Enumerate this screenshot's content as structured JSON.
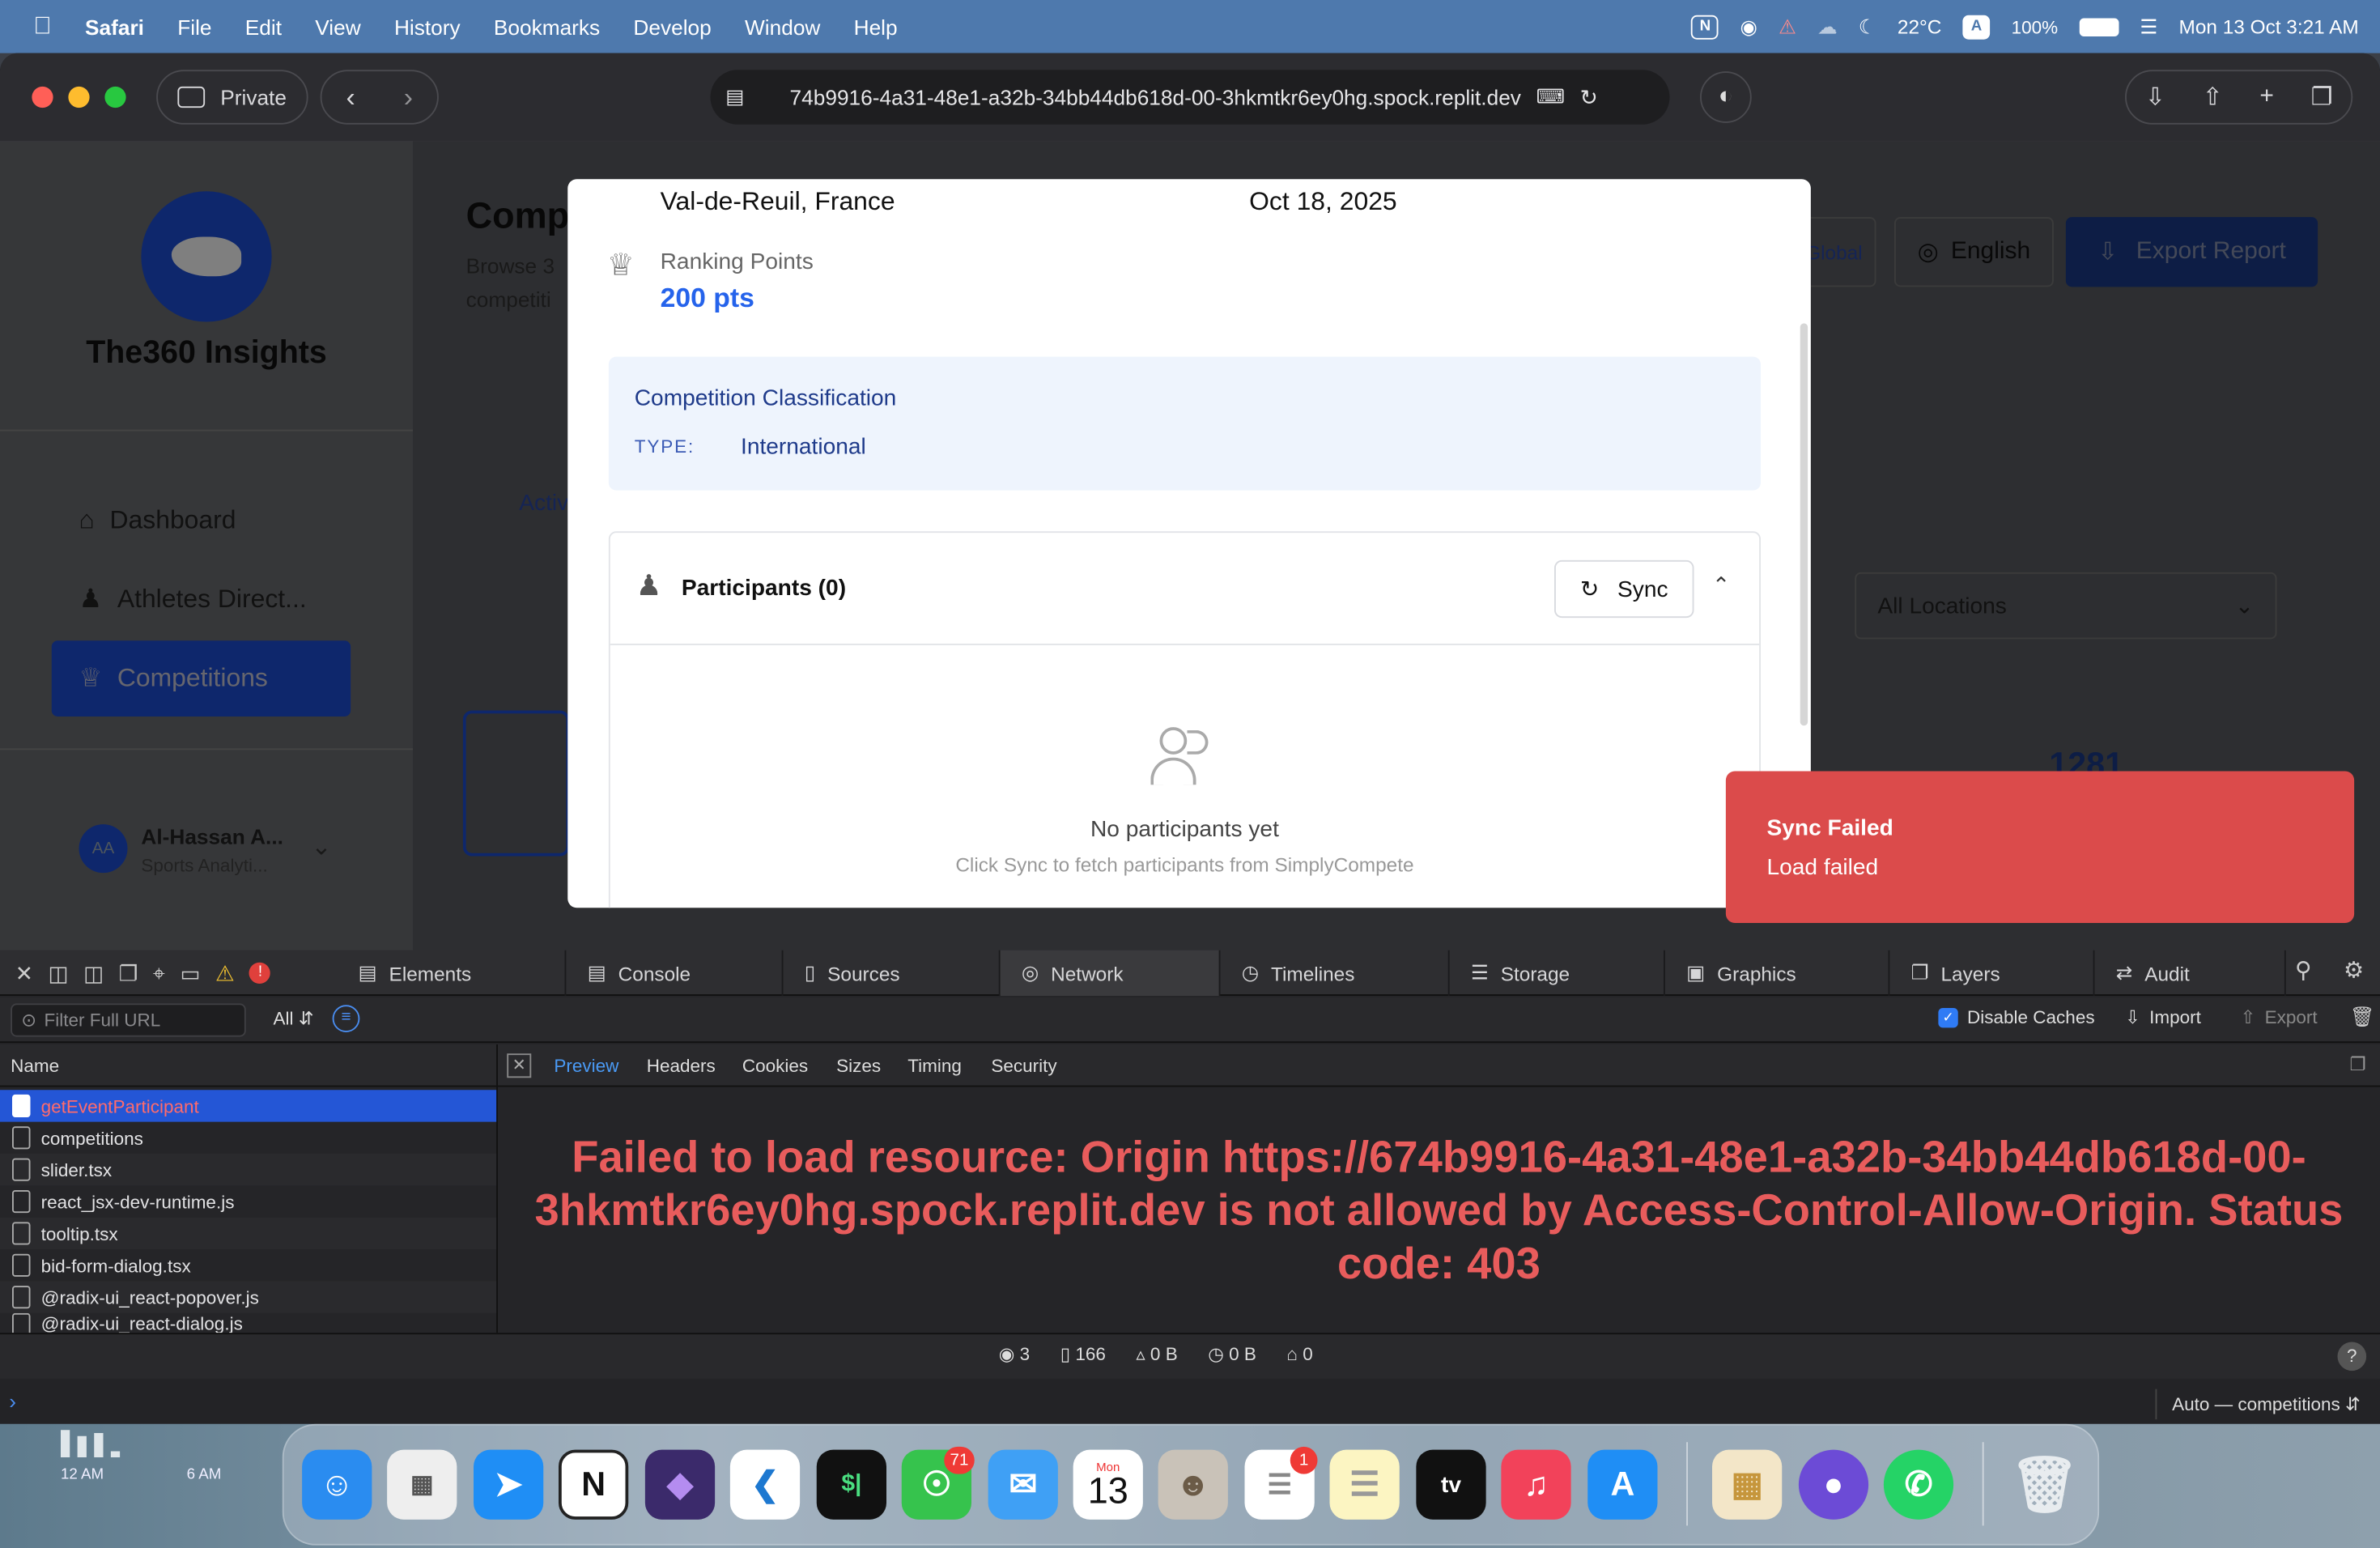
{
  "menubar": {
    "app": "Safari",
    "items": [
      "File",
      "Edit",
      "View",
      "History",
      "Bookmarks",
      "Develop",
      "Window",
      "Help"
    ],
    "temperature": "22°C",
    "input_source": "A",
    "battery": "100%",
    "datetime": "Mon 13 Oct  3:21 AM"
  },
  "browser": {
    "private_label": "Private",
    "url": "74b9916-4a31-48e1-a32b-34bb44db618d-00-3hkmtkr6ey0hg.spock.replit.dev"
  },
  "app": {
    "brand": "The360 Insights",
    "nav": [
      "Dashboard",
      "Athletes Direct...",
      "Competitions"
    ],
    "user_name": "Al-Hassan A...",
    "user_role": "Sports Analyti...",
    "user_initials": "AA",
    "page_title": "Comp",
    "page_sub1": "Browse 3",
    "page_sub2": "competiti",
    "global_btn": "Global",
    "lang_btn": "English",
    "export_btn": "Export Report",
    "tab_partial": "Activ",
    "locations": "All Locations",
    "stat_partial": "1281"
  },
  "modal": {
    "location": "Val-de-Reuil, France",
    "date": "Oct 18, 2025",
    "ranking_label": "Ranking Points",
    "ranking_value": "200 pts",
    "classification_title": "Competition Classification",
    "type_label": "TYPE:",
    "type_value": "International",
    "participants_title": "Participants (0)",
    "sync_label": "Sync",
    "empty_title": "No participants yet",
    "empty_sub": "Click Sync to fetch participants from SimplyCompete"
  },
  "toast": {
    "title": "Sync Failed",
    "message": "Load failed"
  },
  "devtools": {
    "tabs": [
      "Elements",
      "Console",
      "Sources",
      "Network",
      "Timelines",
      "Storage",
      "Graphics",
      "Layers",
      "Audit"
    ],
    "active_tab": "Network",
    "filter_placeholder": "Filter Full URL",
    "type_filter": "All",
    "disable_caches": "Disable Caches",
    "import": "Import",
    "export": "Export",
    "name_header": "Name",
    "requests": [
      "getEventParticipant",
      "competitions",
      "slider.tsx",
      "react_jsx-dev-runtime.js",
      "tooltip.tsx",
      "bid-form-dialog.tsx",
      "@radix-ui_react-popover.js",
      "@radix-ui_react-dialog.js"
    ],
    "detail_tabs": [
      "Preview",
      "Headers",
      "Cookies",
      "Sizes",
      "Timing",
      "Security"
    ],
    "error_message": "Failed to load resource: Origin https://674b9916-4a31-48e1-a32b-34bb44db618d-00-3hkmtkr6ey0hg.spock.replit.dev is not allowed by Access-Control-Allow-Origin. Status code: 403",
    "stats": [
      "3",
      "166",
      "0 B",
      "0 B",
      "0"
    ],
    "context": "Auto — competitions"
  },
  "desktop": {
    "widget_labels": [
      "12 AM",
      "6 AM"
    ],
    "calendar_month": "Mon",
    "calendar_day": "13",
    "messages_badge": "71",
    "reminders_badge": "1"
  },
  "colors": {
    "menubar": "#4e79ad",
    "accent_blue": "#2563eb",
    "toast_red": "#db4b4b",
    "error_text": "#e85c5c",
    "selected_row": "#2456d6"
  }
}
